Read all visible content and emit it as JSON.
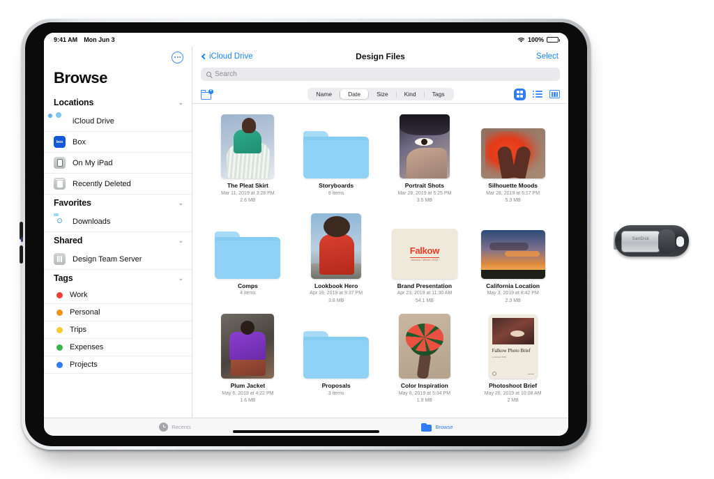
{
  "status_bar": {
    "time": "9:41 AM",
    "date": "Mon Jun 3",
    "battery_percent": "100%",
    "wifi_icon": "wifi-icon",
    "battery_icon": "battery-icon"
  },
  "sidebar": {
    "more_button_icon": "ellipsis-circle-icon",
    "title": "Browse",
    "sections": [
      {
        "header": "Locations",
        "chevron": "⌄",
        "items": [
          {
            "label": "iCloud Drive",
            "icon": "icloud-drive-icon"
          },
          {
            "label": "Box",
            "icon": "box-app-icon",
            "icon_text": "box"
          },
          {
            "label": "On My iPad",
            "icon": "ipad-icon"
          },
          {
            "label": "Recently Deleted",
            "icon": "trash-icon"
          }
        ]
      },
      {
        "header": "Favorites",
        "chevron": "⌄",
        "items": [
          {
            "label": "Downloads",
            "icon": "downloads-folder-icon"
          }
        ]
      },
      {
        "header": "Shared",
        "chevron": "⌄",
        "items": [
          {
            "label": "Design Team Server",
            "icon": "server-icon"
          }
        ]
      },
      {
        "header": "Tags",
        "chevron": "⌄",
        "items": [
          {
            "label": "Work",
            "icon": "tag-dot-icon",
            "color": "#ef4136"
          },
          {
            "label": "Personal",
            "icon": "tag-dot-icon",
            "color": "#f0941f"
          },
          {
            "label": "Trips",
            "icon": "tag-dot-icon",
            "color": "#f5cc33"
          },
          {
            "label": "Expenses",
            "icon": "tag-dot-icon",
            "color": "#3cb44b"
          },
          {
            "label": "Projects",
            "icon": "tag-dot-icon",
            "color": "#2f7cf6"
          }
        ]
      }
    ]
  },
  "navbar": {
    "back_label": "iCloud Drive",
    "back_icon": "chevron-left-icon",
    "title": "Design Files",
    "select_label": "Select"
  },
  "search": {
    "placeholder": "Search",
    "icon": "search-icon",
    "value": ""
  },
  "toolbar": {
    "new_folder_icon": "new-folder-icon",
    "new_folder_badge": "+",
    "sort_options": [
      {
        "label": "Name",
        "selected": false
      },
      {
        "label": "Date",
        "selected": true
      },
      {
        "label": "Size",
        "selected": false
      },
      {
        "label": "Kind",
        "selected": false
      },
      {
        "label": "Tags",
        "selected": false
      }
    ],
    "views": [
      {
        "name": "grid-view-icon",
        "selected": true
      },
      {
        "name": "list-view-icon",
        "selected": false
      },
      {
        "name": "column-view-icon",
        "selected": false
      }
    ]
  },
  "files": {
    "rows": [
      [
        {
          "name": "The Pleat Skirt",
          "meta1": "Mar 11, 2019 at 3:28 PM",
          "meta2": "2.6 MB",
          "kind": "photo",
          "thumb": "t-pleat"
        },
        {
          "name": "Storyboards",
          "meta1": "8 items",
          "meta2": "",
          "kind": "folder",
          "thumb": "folder"
        },
        {
          "name": "Portrait Shots",
          "meta1": "Mar 28, 2019 at 5:25 PM",
          "meta2": "3.5 MB",
          "kind": "photo",
          "thumb": "t-portrait"
        },
        {
          "name": "Silhouette Moods",
          "meta1": "Mar 28, 2019 at 6:17 PM",
          "meta2": "5.3 MB",
          "kind": "photo",
          "thumb": "t-silhouette"
        }
      ],
      [
        {
          "name": "Comps",
          "meta1": "4 items",
          "meta2": "",
          "kind": "folder",
          "thumb": "folder"
        },
        {
          "name": "Lookbook Hero",
          "meta1": "Apr 19, 2019 at 9:37 PM",
          "meta2": "3.8 MB",
          "kind": "photo",
          "thumb": "t-lookbook"
        },
        {
          "name": "Brand Presentation",
          "meta1": "Apr 23, 2019 at 11:30 AM",
          "meta2": "54.1 MB",
          "kind": "document",
          "thumb": "t-brand"
        },
        {
          "name": "California Location",
          "meta1": "May 3, 2019 at 8:42 PM",
          "meta2": "2.3 MB",
          "kind": "photo",
          "thumb": "t-california"
        }
      ],
      [
        {
          "name": "Plum Jacket",
          "meta1": "May 6, 2019 at 4:22 PM",
          "meta2": "1.6 MB",
          "kind": "photo",
          "thumb": "t-plum"
        },
        {
          "name": "Proposals",
          "meta1": "3 items",
          "meta2": "",
          "kind": "folder",
          "thumb": "folder"
        },
        {
          "name": "Color Inspiration",
          "meta1": "May 6, 2019 at 5:34 PM",
          "meta2": "1.9 MB",
          "kind": "photo",
          "thumb": "t-color"
        },
        {
          "name": "Photoshoot Brief",
          "meta1": "May 26, 2019 at 10:08 AM",
          "meta2": "2 MB",
          "kind": "document",
          "thumb": "t-photobrief"
        }
      ]
    ]
  },
  "thumbnail_text": {
    "brand_presentation_title": "Falkow",
    "brand_presentation_subtitle": "Autumn / Winter 2019",
    "photo_brief_title": "Falkow\nPhoto Brief",
    "photo_brief_subtitle": "Lookbook 2019"
  },
  "tabbar": {
    "tabs": [
      {
        "label": "Recents",
        "icon": "clock-icon",
        "active": false
      },
      {
        "label": "Browse",
        "icon": "folder-icon",
        "active": true
      }
    ]
  },
  "device": {
    "usb_drive_brand": "SanDisk"
  },
  "colors": {
    "accent_blue": "#1a84ff",
    "folder_blue": "#8fd2f5",
    "segment_bg": "#ededf0"
  }
}
